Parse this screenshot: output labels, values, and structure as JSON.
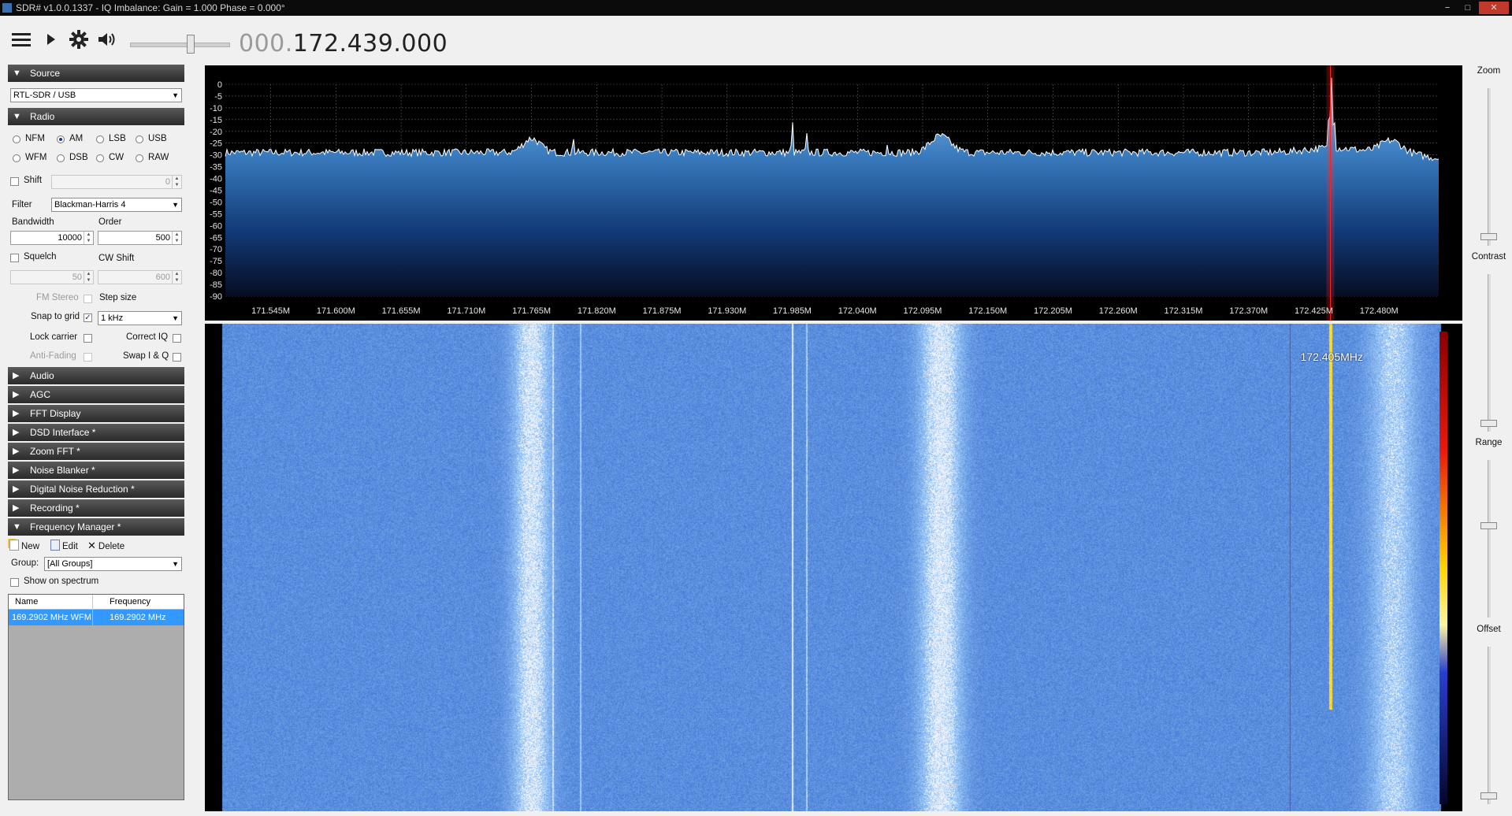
{
  "window": {
    "title": "SDR# v1.0.0.1337 - IQ Imbalance: Gain = 1.000 Phase = 0.000°",
    "min_label": "−",
    "max_label": "□",
    "close_label": "✕"
  },
  "toolbar": {
    "frequency_prefix": "000.",
    "frequency_main": "172.439.000"
  },
  "source": {
    "header": "Source",
    "device": "RTL-SDR / USB"
  },
  "radio": {
    "header": "Radio",
    "modes": [
      "NFM",
      "AM",
      "LSB",
      "USB",
      "WFM",
      "DSB",
      "CW",
      "RAW"
    ],
    "selected_mode": "AM",
    "shift_label": "Shift",
    "shift_value": "0",
    "filter_label": "Filter",
    "filter_value": "Blackman-Harris 4",
    "bandwidth_label": "Bandwidth",
    "bandwidth_value": "10000",
    "order_label": "Order",
    "order_value": "500",
    "squelch_label": "Squelch",
    "squelch_value": "50",
    "cw_shift_label": "CW Shift",
    "cw_shift_value": "600",
    "fm_stereo_label": "FM Stereo",
    "step_size_label": "Step size",
    "snap_label": "Snap to grid",
    "step_value": "1 kHz",
    "lock_carrier_label": "Lock carrier",
    "correct_iq_label": "Correct IQ",
    "anti_fading_label": "Anti-Fading",
    "swap_iq_label": "Swap I & Q"
  },
  "panels": [
    "Audio",
    "AGC",
    "FFT Display",
    "DSD Interface *",
    "Zoom FFT *",
    "Noise Blanker *",
    "Digital Noise Reduction *",
    "Recording *"
  ],
  "frequency_manager": {
    "header": "Frequency Manager *",
    "new_label": "New",
    "edit_label": "Edit",
    "delete_label": "Delete",
    "group_label": "Group:",
    "group_value": "[All Groups]",
    "show_on_spectrum_label": "Show on spectrum",
    "columns": [
      "Name",
      "Frequency"
    ],
    "rows": [
      {
        "name": "169.2902 MHz WFM",
        "frequency": "169.2902 MHz"
      }
    ]
  },
  "spectrum": {
    "db_labels": [
      "0",
      "-5",
      "-10",
      "-15",
      "-20",
      "-25",
      "-30",
      "-35",
      "-40",
      "-45",
      "-50",
      "-55",
      "-60",
      "-65",
      "-70",
      "-75",
      "-80",
      "-85",
      "-90"
    ],
    "freq_labels": [
      "171.545M",
      "171.600M",
      "171.655M",
      "171.710M",
      "171.765M",
      "171.820M",
      "171.875M",
      "171.930M",
      "171.985M",
      "172.040M",
      "172.095M",
      "172.150M",
      "172.205M",
      "172.260M",
      "172.315M",
      "172.370M",
      "172.425M",
      "172.480M"
    ],
    "db_range": [
      -90,
      0
    ],
    "freq_start_mhz": 171.5067,
    "freq_end_mhz": 172.5304,
    "tuned_frequency_mhz": 172.439,
    "marker_frequency_mhz": 172.405,
    "signal_color": "#ffffff",
    "fill_color_top": "#7fb2de",
    "fill_color_bottom": "#08122a"
  },
  "waterfall": {
    "marker_label": "172.405MHz"
  },
  "right_panel": {
    "zoom_label": "Zoom",
    "contrast_label": "Contrast",
    "range_label": "Range",
    "offset_label": "Offset"
  }
}
